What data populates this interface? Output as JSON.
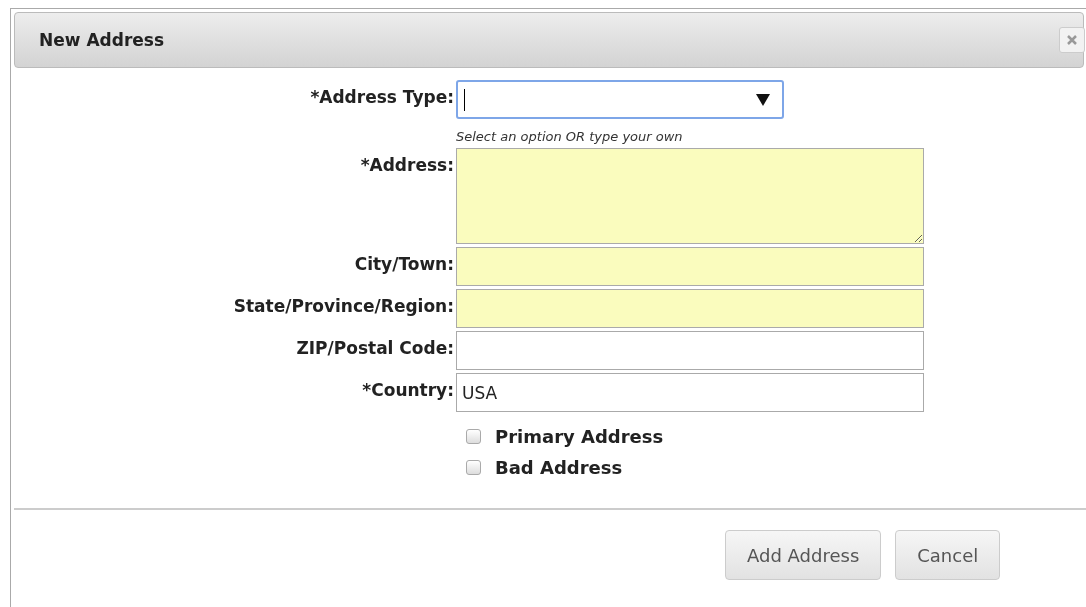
{
  "dialog": {
    "title": "New Address"
  },
  "fields": [
    {
      "kind": "select",
      "label": "*Address Type:",
      "focused": true,
      "highlighted": false,
      "hint": "Select an option OR type your own"
    },
    {
      "kind": "textarea",
      "label": "*Address:",
      "focused": false,
      "highlighted": true
    },
    {
      "kind": "text",
      "label": "City/Town:",
      "focused": false,
      "highlighted": true
    },
    {
      "kind": "text",
      "label": "State/Province/Region:",
      "focused": false,
      "highlighted": true
    },
    {
      "kind": "text",
      "label": "ZIP/Postal Code:",
      "focused": false,
      "highlighted": false
    },
    {
      "kind": "text",
      "label": "*Country:",
      "value": "USA",
      "focused": false,
      "highlighted": false
    }
  ],
  "checkboxes": [
    {
      "label": "Primary Address",
      "checked": false
    },
    {
      "label": "Bad Address",
      "checked": false
    }
  ],
  "buttons": [
    "Add Address",
    "Cancel"
  ]
}
